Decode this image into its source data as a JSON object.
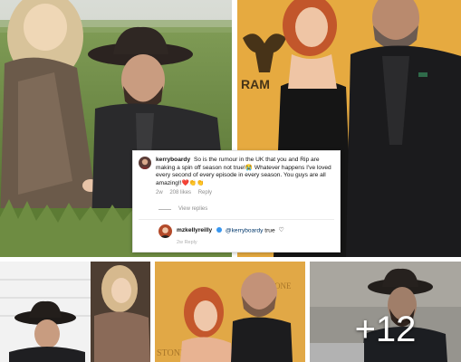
{
  "gallery": {
    "more_count_label": "+12"
  },
  "comment": {
    "username": "kerryboardy",
    "text": "So is the rumour in the UK that you and Rip are making a spin off season not true!😭 Whatever happens I've loved every second of every episode in every season. You guys are all amazing!!❤️👏👏",
    "age": "2w",
    "likes": "208 likes",
    "reply_label": "Reply",
    "view_replies_label": "View replies"
  },
  "reply": {
    "username": "mzkellyreilly",
    "mention": "@kerryboardy",
    "text": "true",
    "age": "2w",
    "reply_label": "Reply"
  },
  "poster_texts": {
    "ram_logo_text": "RAM",
    "poster_text_a": "ONE",
    "poster_text_b": "STONE"
  }
}
